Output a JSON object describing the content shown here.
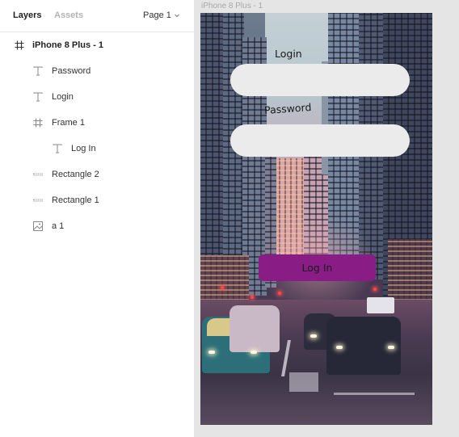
{
  "panel": {
    "tabs": [
      {
        "label": "Layers"
      },
      {
        "label": "Assets"
      }
    ],
    "page_selector": {
      "label": "Page 1"
    },
    "layers": [
      {
        "label": "iPhone 8 Plus - 1",
        "icon": "frame-icon"
      },
      {
        "label": "Password",
        "icon": "text-icon"
      },
      {
        "label": "Login",
        "icon": "text-icon"
      },
      {
        "label": "Frame 1",
        "icon": "frame-icon"
      },
      {
        "label": "Log In",
        "icon": "text-icon"
      },
      {
        "label": "Rectangle 2",
        "icon": "rectangle-icon"
      },
      {
        "label": "Rectangle 1",
        "icon": "rectangle-icon"
      },
      {
        "label": "a 1",
        "icon": "image-icon"
      }
    ]
  },
  "canvas": {
    "frame_title": "iPhone 8 Plus - 1",
    "form": {
      "login_label": "Login",
      "password_label": "Password",
      "button_label": "Log In"
    }
  },
  "colors": {
    "button": "#8a1c86",
    "field": "#ebebeb",
    "canvas_bg": "#e5e5e5"
  }
}
